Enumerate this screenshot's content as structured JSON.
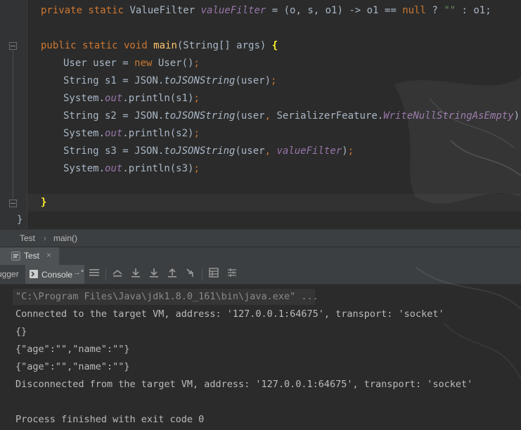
{
  "editor": {
    "lines": [
      {
        "id": "filter",
        "tokens": [
          {
            "t": "private static ",
            "c": "kw"
          },
          {
            "t": "ValueFilter ",
            "c": ""
          },
          {
            "t": "valueFilter",
            "c": "fld"
          },
          {
            "t": " = (o, s, o1) -> o1 == ",
            "c": ""
          },
          {
            "t": "null",
            "c": "kw"
          },
          {
            "t": " ? ",
            "c": ""
          },
          {
            "t": "\"\"",
            "c": "str"
          },
          {
            "t": " : o1;",
            "c": ""
          }
        ]
      },
      {
        "id": "main",
        "tokens": [
          {
            "t": "public static void ",
            "c": "kw"
          },
          {
            "t": "main",
            "c": "fn"
          },
          {
            "t": "(String[] args) ",
            "c": ""
          },
          {
            "t": "{",
            "c": "brace"
          }
        ]
      },
      {
        "id": "user",
        "tokens": [
          {
            "t": "User user = ",
            "c": ""
          },
          {
            "t": "new ",
            "c": "kw"
          },
          {
            "t": "User()",
            "c": ""
          },
          {
            "t": ";",
            "c": "kw"
          }
        ]
      },
      {
        "id": "s1",
        "tokens": [
          {
            "t": "String s1 = JSON.",
            "c": ""
          },
          {
            "t": "toJSONString",
            "c": "st"
          },
          {
            "t": "(user)",
            "c": ""
          },
          {
            "t": ";",
            "c": "kw"
          }
        ]
      },
      {
        "id": "p1",
        "tokens": [
          {
            "t": "System.",
            "c": ""
          },
          {
            "t": "out",
            "c": "fld"
          },
          {
            "t": ".println(s1)",
            "c": ""
          },
          {
            "t": ";",
            "c": "kw"
          }
        ]
      },
      {
        "id": "s2",
        "tokens": [
          {
            "t": "String s2 = JSON.",
            "c": ""
          },
          {
            "t": "toJSONString",
            "c": "st"
          },
          {
            "t": "(user",
            "c": ""
          },
          {
            "t": ", ",
            "c": "kw"
          },
          {
            "t": "SerializerFeature.",
            "c": ""
          },
          {
            "t": "WriteNullStringAsEmpty",
            "c": "fld"
          },
          {
            "t": ")",
            "c": ""
          },
          {
            "t": ";",
            "c": "kw"
          }
        ]
      },
      {
        "id": "p2",
        "tokens": [
          {
            "t": "System.",
            "c": ""
          },
          {
            "t": "out",
            "c": "fld"
          },
          {
            "t": ".println(s2)",
            "c": ""
          },
          {
            "t": ";",
            "c": "kw"
          }
        ]
      },
      {
        "id": "s3",
        "tokens": [
          {
            "t": "String s3 = JSON.",
            "c": ""
          },
          {
            "t": "toJSONString",
            "c": "st"
          },
          {
            "t": "(user",
            "c": ""
          },
          {
            "t": ", ",
            "c": "kw"
          },
          {
            "t": "valueFilter",
            "c": "fld"
          },
          {
            "t": ")",
            "c": ""
          },
          {
            "t": ";",
            "c": "kw"
          }
        ]
      },
      {
        "id": "p3",
        "tokens": [
          {
            "t": "System.",
            "c": ""
          },
          {
            "t": "out",
            "c": "fld"
          },
          {
            "t": ".println(s3)",
            "c": ""
          },
          {
            "t": ";",
            "c": "kw"
          }
        ]
      },
      {
        "id": "close-method",
        "tokens": [
          {
            "t": "}",
            "c": "brace"
          }
        ]
      },
      {
        "id": "close-class",
        "tokens": [
          {
            "t": "}",
            "c": ""
          }
        ]
      }
    ]
  },
  "breadcrumb": {
    "class_name": "Test",
    "separator": "›",
    "method": "main()"
  },
  "run_tab": {
    "label": "Test",
    "close": "×"
  },
  "toolbar": {
    "debugger_label": "ugger",
    "console_label": "Console",
    "pin_label": "→*"
  },
  "console": {
    "lines": [
      "\"C:\\Program Files\\Java\\jdk1.8.0_161\\bin\\java.exe\" ...",
      "Connected to the target VM, address: '127.0.0.1:64675', transport: 'socket'",
      "{}",
      "{\"age\":\"\",\"name\":\"\"}",
      "{\"age\":\"\",\"name\":\"\"}",
      "Disconnected from the target VM, address: '127.0.0.1:64675', transport: 'socket'",
      "",
      "Process finished with exit code 0"
    ]
  },
  "colors": {
    "keyword": "#cc7832",
    "method": "#ffc66d",
    "field": "#9876aa",
    "string": "#6a8759",
    "text": "#a9b7c6",
    "background": "#2b2b2b",
    "panel": "#3c3f41"
  }
}
